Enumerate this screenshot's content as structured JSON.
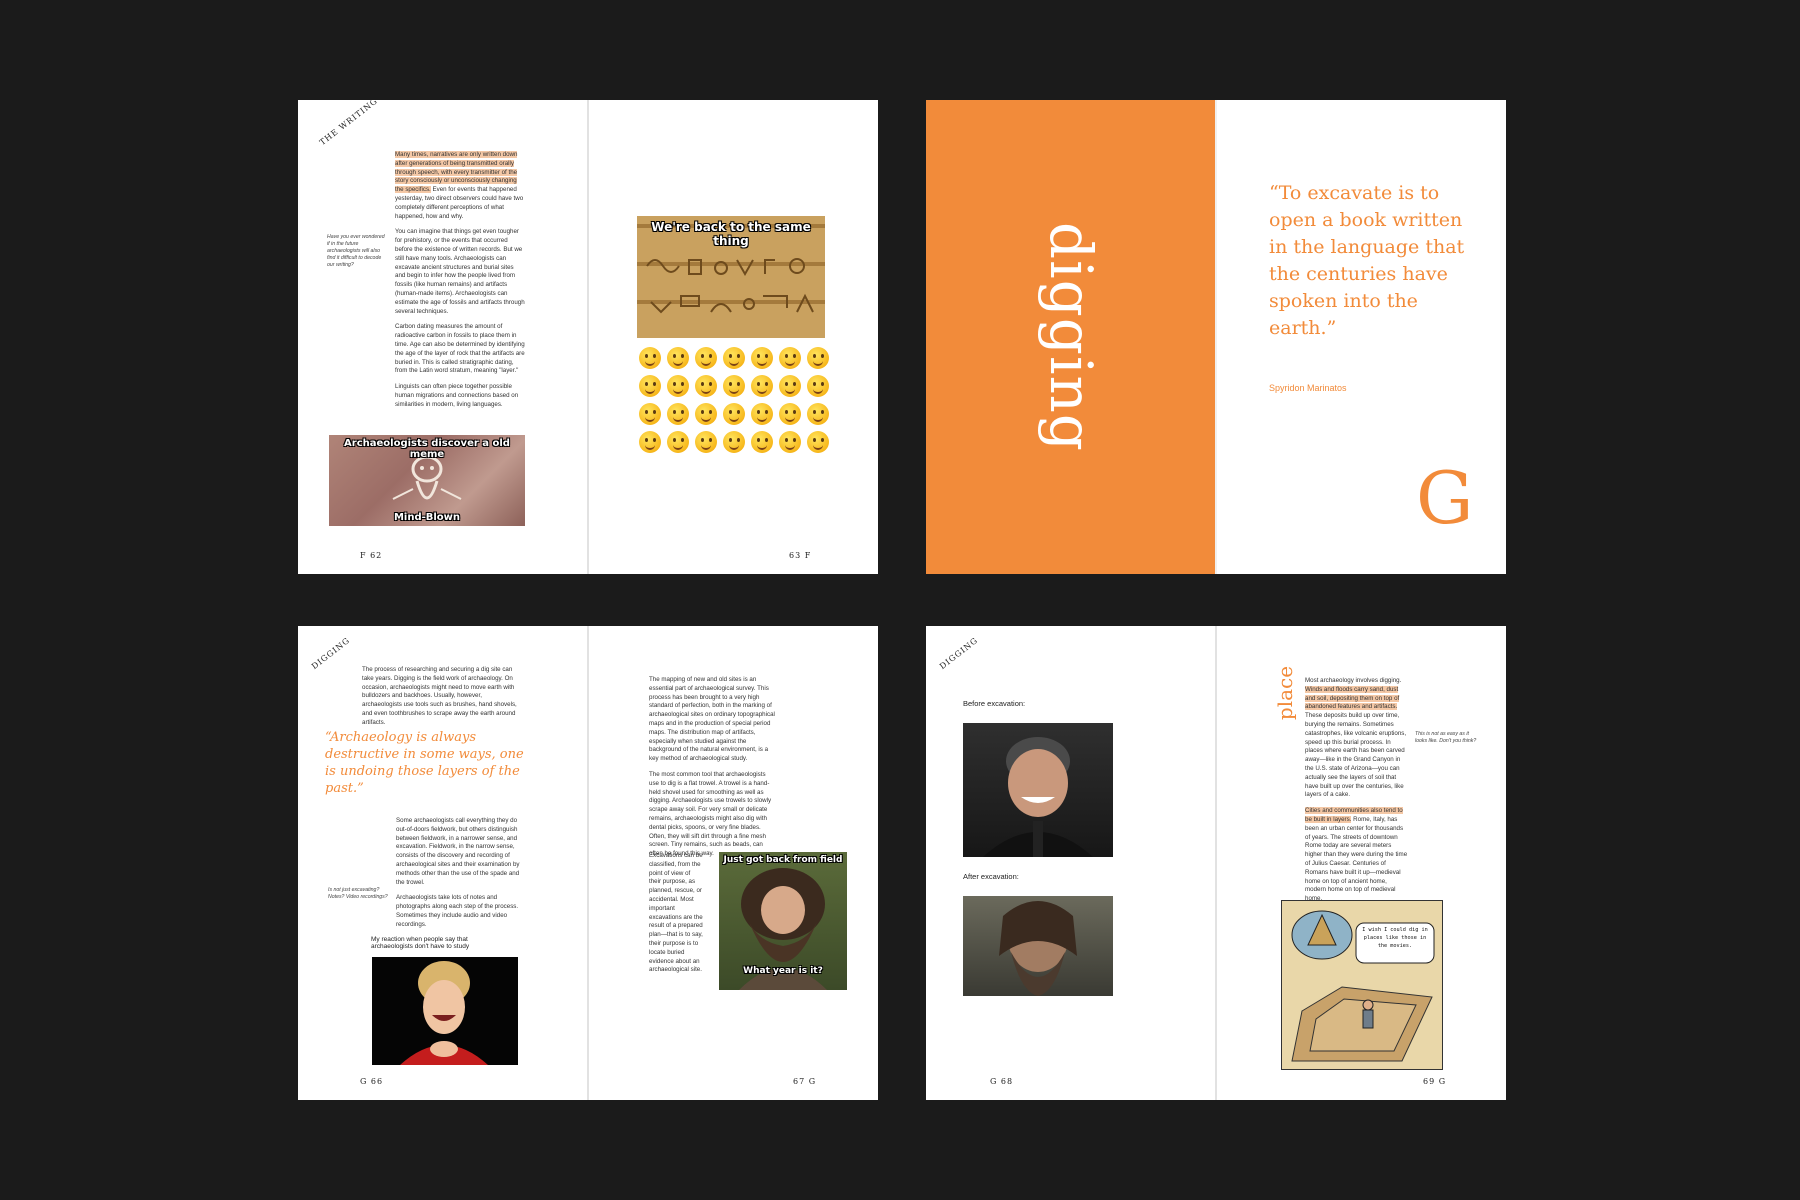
{
  "spread1": {
    "running_head": "THE WRITING",
    "side_note": "Have you ever wondered if in the future archaeologists will also find it difficult to decode our writing?",
    "para1_highlight": "Many times, narratives are only written down after generations of being transmitted orally through speech, with every transmitter of the story consciously or unconsciously changing the specifics.",
    "para1_rest": " Even for events that happened yesterday, two direct observers could have two completely different perceptions of what happened, how and why.",
    "para2": "You can imagine that things get even tougher for prehistory, or the events that occurred before the existence of written records. But we still have many tools. Archaeologists can excavate ancient structures and burial sites and begin to infer how the people lived from fossils (like human remains) and artifacts (human-made items). Archaeologists can estimate the age of fossils and artifacts through several techniques.",
    "para3": "Carbon dating measures the amount of radioactive carbon in fossils to place them in time. Age can also be determined by identifying the age of the layer of rock that the artifacts are buried in. This is called stratigraphic dating, from the Latin word stratum, meaning \"layer.\"",
    "para4": "Linguists can often piece together possible human migrations and connections based on similarities in modern, living languages.",
    "meme1_top": "Archaeologists discover a old meme",
    "meme1_bottom": "Mind-Blown",
    "meme2_top": "We're back to the same thing",
    "folio_left": "F 62",
    "folio_right": "63 F"
  },
  "spread2": {
    "title": "digging",
    "quote": "“To excavate is to open a book written in the language that the centuries have spoken into the earth.”",
    "attribution": "Spyridon Marinatos",
    "letter": "G",
    "accent": "#f28b3a"
  },
  "spread3": {
    "running_head": "DIGGING",
    "intro": "The process of researching and securing a dig site can take years. Digging is the field work of archaeology. On occasion, archaeologists might need to move earth with bulldozers and backhoes. Usually, however, archaeologists use tools such as brushes, hand shovels, and even toothbrushes to scrape away the earth around artifacts.",
    "quote": "“Archaeology is always destructive in some ways, one is undoing those layers of the past.”",
    "para_a": "Some archaeologists call everything they do out-of-doors fieldwork, but others distinguish between fieldwork, in a narrower sense, and excavation. Fieldwork, in the narrow sense, consists of the discovery and recording of archaeological sites and their examination by methods other than the use of the spade and the trowel.",
    "side_note": "Is not just excavating? Notes? Video recordings?",
    "para_b": "Archaeologists take lots of notes and photographs along each step of the process. Sometimes they include audio and video recordings.",
    "caption": "My reaction when people say that archaeologists don't have to study",
    "right_p1": "The mapping of new and old sites is an essential part of archaeological survey. This process has been brought to a very high standard of perfection, both in the marking of archaeological sites on ordinary topographical maps and in the production of special period maps. The distribution map of artifacts, especially when studied against the background of the natural environment, is a key method of archaeological study.",
    "right_p2": "The most common tool that archaeologists use to dig is a flat trowel. A trowel is a hand-held shovel used for smoothing as well as digging. Archaeologists use trowels to slowly scrape away soil. For very small or delicate remains, archaeologists might also dig with dental picks, spoons, or very fine blades. Often, they will sift dirt through a fine mesh screen. Tiny remains, such as beads, can often be found this way.",
    "right_p3": "Excavations can be classified, from the point of view of their purpose, as planned, rescue, or accidental. Most important excavations are the result of a prepared plan—that is to say, their purpose is to locate buried evidence about an archaeological site.",
    "meme_top": "Just got back from field",
    "meme_bottom": "What year is it?",
    "folio_left": "G 66",
    "folio_right": "67 G"
  },
  "spread4": {
    "running_head": "DIGGING",
    "before": "Before excavation:",
    "after": "After excavation:",
    "side_title": "place",
    "p1_pre": "Most archaeology involves digging. ",
    "p1_hl": "Winds and floods carry sand, dust and soil, depositing them on top of abandoned features and artifacts.",
    "p1_post": " These deposits build up over time, burying the remains. Sometimes catastrophes, like volcanic eruptions, speed up this burial process. In places where earth has been carved away—like in the Grand Canyon in the U.S. state of Arizona—you can actually see the layers of soil that have built up over the centuries, like layers of a cake.",
    "p2_hl": "Cities and communities also tend to be built in layers.",
    "p2_post": " Rome, Italy, has been an urban center for thousands of years. The streets of downtown Rome today are several meters higher than they were during the time of Julius Caesar. Centuries of Romans have built it up—medieval home on top of ancient home, modern home on top of medieval home.",
    "side_note": "This is not as easy as it looks like. Don't you think?",
    "comic_text": "I wish I could dig in places like those in the movies.",
    "folio_left": "G 68",
    "folio_right": "69 G"
  }
}
